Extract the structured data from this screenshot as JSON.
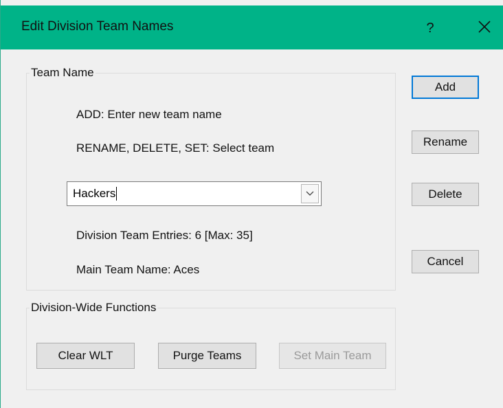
{
  "window": {
    "title": "Edit Division Team Names",
    "help_label": "?",
    "close_icon": "close-icon"
  },
  "team_name_group": {
    "label": "Team Name",
    "add_hint": "ADD: Enter new team name",
    "select_hint": "RENAME, DELETE, SET:  Select team",
    "combo_value": "Hackers",
    "entries_text": "Division Team Entries: 6 [Max: 35]",
    "main_team_text": "Main Team Name: Aces"
  },
  "side_buttons": {
    "add": "Add",
    "rename": "Rename",
    "delete": "Delete",
    "cancel": "Cancel"
  },
  "division_group": {
    "label": "Division-Wide Functions",
    "clear_wlt": "Clear WLT",
    "purge_teams": "Purge Teams",
    "set_main_team": "Set Main Team"
  },
  "colors": {
    "titlebar": "#00b388",
    "dialog_bg": "#f0f0f0",
    "default_button_border": "#0078d7"
  }
}
